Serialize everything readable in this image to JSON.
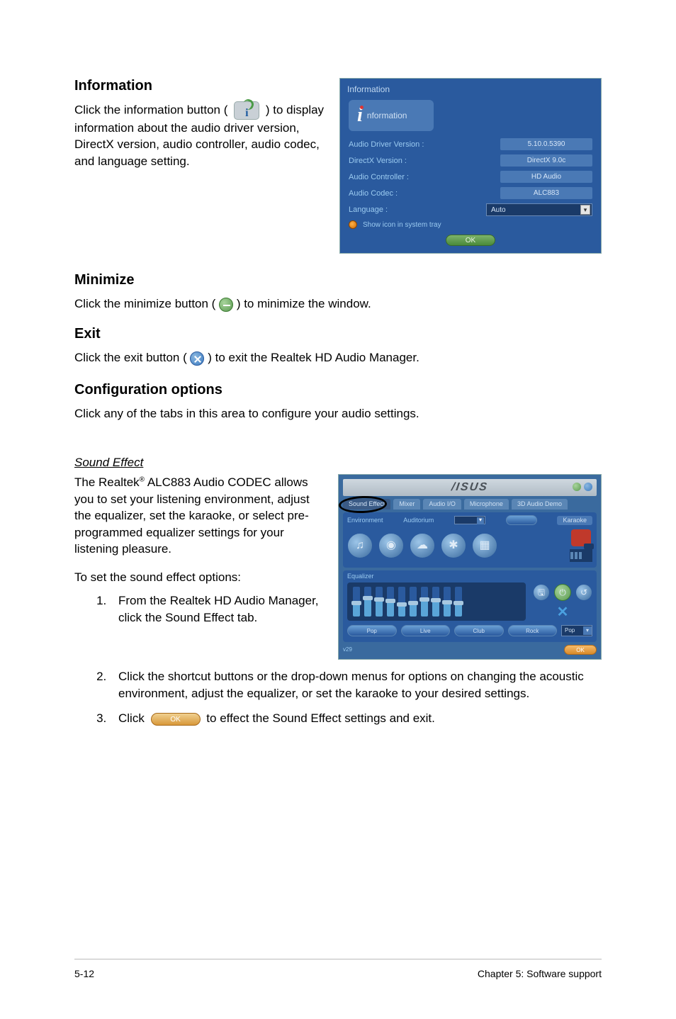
{
  "sections": {
    "info": {
      "heading": "Information",
      "body_pre": "Click the information button ( ",
      "body_post": " ) to display information about the audio driver version, DirectX version, audio controller, audio codec, and language setting."
    },
    "minimize": {
      "heading": "Minimize",
      "body_pre": "Click the minimize button (",
      "body_post": ") to minimize the window."
    },
    "exit": {
      "heading": "Exit",
      "body_pre": "Click the exit button (",
      "body_post": ") to exit the Realtek HD Audio Manager."
    },
    "config": {
      "heading": "Configuration options",
      "body": "Click any of the tabs in this area to configure your audio settings."
    },
    "soundeffect": {
      "heading": "Sound Effect",
      "body": "The Realtek",
      "reg": "®",
      "body2": " ALC883 Audio CODEC allows you to set your listening environment, adjust the equalizer, set the karaoke, or select pre-programmed equalizer settings for your listening pleasure.",
      "toset": "To set the sound effect options:"
    }
  },
  "info_panel": {
    "title": "Information",
    "chip": "nformation",
    "rows": {
      "driver_label": "Audio Driver Version :",
      "driver_value": "5.10.0.5390",
      "directx_label": "DirectX Version :",
      "directx_value": "DirectX 9.0c",
      "controller_label": "Audio Controller :",
      "controller_value": "HD Audio",
      "codec_label": "Audio Codec :",
      "codec_value": "ALC883",
      "language_label": "Language :",
      "language_value": "Auto",
      "showicon": "Show icon in system tray"
    },
    "ok": "OK"
  },
  "asus_panel": {
    "logo": "/ISUS",
    "tabs": [
      "Sound Effect",
      "Mixer",
      "Audio I/O",
      "Microphone",
      "3D Audio Demo"
    ],
    "env_label": "Environment",
    "env_sub": "Auditorium",
    "karaoke": "Karaoke",
    "eq_label": "Equalizer",
    "presets": [
      "Pop",
      "Live",
      "Club",
      "Rock"
    ],
    "preset_sel": "Pop",
    "footer_left": "v29",
    "ok": "OK"
  },
  "steps": [
    "From the Realtek HD Audio Manager, click the Sound Effect tab.",
    "Click the shortcut buttons or the drop-down menus for options on changing the acoustic environment, adjust the equalizer, or set the karaoke to your desired settings.",
    {
      "pre": "Click ",
      "btn": "OK",
      "post": " to effect the Sound Effect settings and exit."
    }
  ],
  "footer": {
    "left": "5-12",
    "right": "Chapter 5: Software support"
  }
}
